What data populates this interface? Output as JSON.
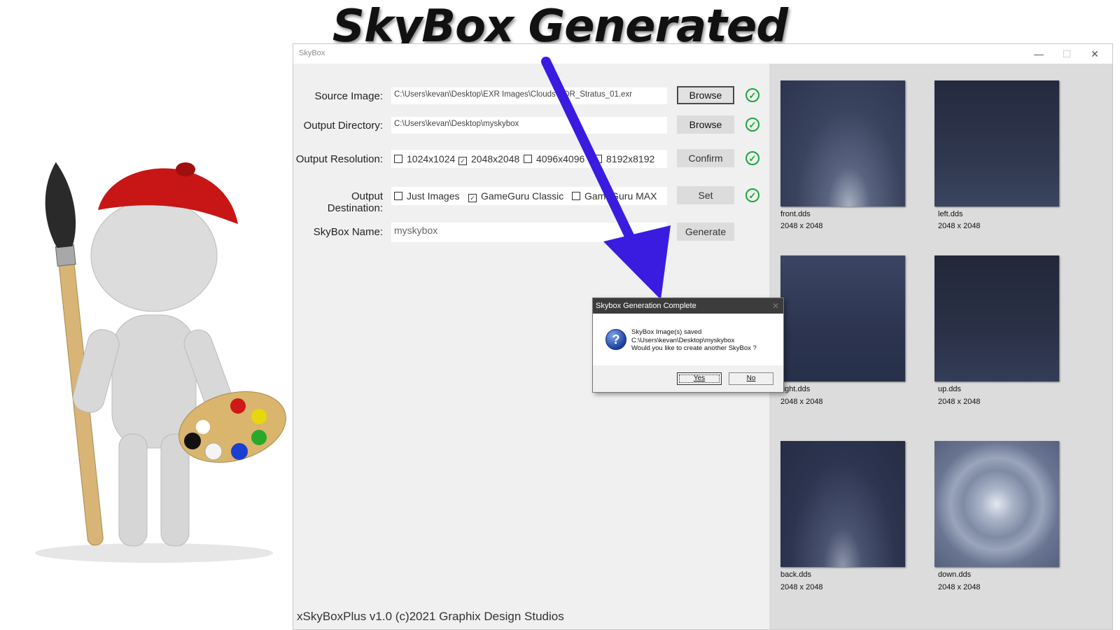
{
  "headline": "SkyBox Generated",
  "window": {
    "title": "SkyBox",
    "controls": {
      "minimize": "—",
      "maximize": "☐",
      "close": "✕"
    }
  },
  "form": {
    "source_image": {
      "label": "Source Image:",
      "value": "C:\\Users\\kevan\\Desktop\\EXR Images\\Clouds\\HDR_Stratus_01.exr",
      "button": "Browse"
    },
    "output_directory": {
      "label": "Output Directory:",
      "value": "C:\\Users\\kevan\\Desktop\\myskybox",
      "button": "Browse"
    },
    "output_resolution": {
      "label": "Output Resolution:",
      "options": [
        {
          "label": "1024x1024",
          "checked": false
        },
        {
          "label": "2048x2048",
          "checked": true
        },
        {
          "label": "4096x4096",
          "checked": false
        },
        {
          "label": "8192x8192",
          "checked": false
        }
      ],
      "button": "Confirm"
    },
    "output_destination": {
      "label": "Output Destination:",
      "options": [
        {
          "label": "Just Images",
          "checked": false
        },
        {
          "label": "GameGuru Classic",
          "checked": true
        },
        {
          "label": "GameGuru MAX",
          "checked": false
        }
      ],
      "button": "Set"
    },
    "skybox_name": {
      "label": "SkyBox Name:",
      "value": "myskybox",
      "button": "Generate"
    }
  },
  "footer": "xSkyBoxPlus v1.0 (c)2021 Graphix Design Studios",
  "previews": [
    {
      "name": "front.dds",
      "size": "2048 x 2048"
    },
    {
      "name": "left.dds",
      "size": "2048 x 2048"
    },
    {
      "name": "right.dds",
      "size": "2048 x 2048"
    },
    {
      "name": "up.dds",
      "size": "2048 x 2048"
    },
    {
      "name": "back.dds",
      "size": "2048 x 2048"
    },
    {
      "name": "down.dds",
      "size": "2048 x 2048"
    }
  ],
  "dialog": {
    "title": "Skybox Generation Complete",
    "line1": "SkyBox Image(s) saved",
    "line2": "C:\\Users\\kevan\\Desktop\\myskybox",
    "line3": "Would you like to create another SkyBox ?",
    "yes": "Yes",
    "no": "No"
  },
  "colors": {
    "check_green": "#1aa83a",
    "arrow": "#3a1be0",
    "dialog_title_bg": "#3c3c3c"
  }
}
